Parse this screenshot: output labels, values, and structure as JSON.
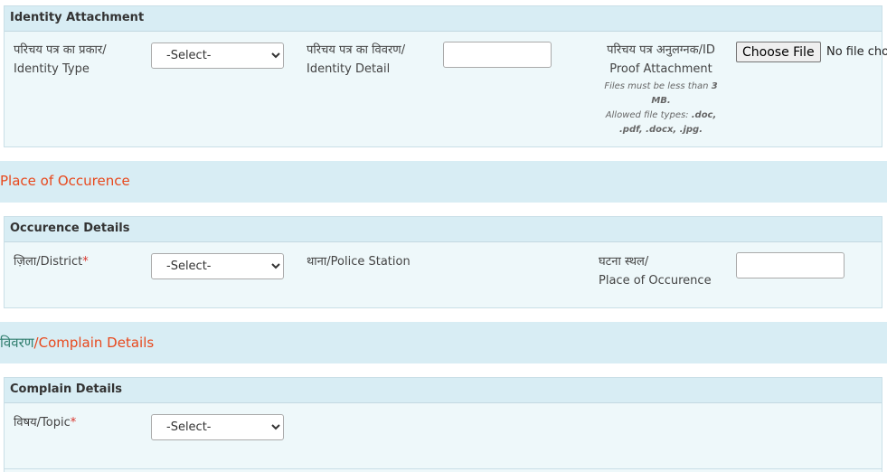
{
  "identity": {
    "header": "Identity Attachment",
    "type_label": [
      "परिचय पत्र का प्रकार/",
      "Identity Type"
    ],
    "type_select": "-Select-",
    "detail_label": [
      "परिचय पत्र का विवरण/",
      "Identity Detail"
    ],
    "detail_value": "",
    "attach_label": [
      "परिचय पत्र अनुलग्नक/ID",
      "Proof Attachment"
    ],
    "size_note": [
      "Files must be less than ",
      "3",
      "MB."
    ],
    "types_note": [
      "Allowed file types: ",
      ".doc,",
      ".pdf, .docx, .jpg."
    ],
    "choose_button": "Choose File",
    "no_file": "No file chosen"
  },
  "place_band": {
    "title": "Place of Occurence"
  },
  "occurence": {
    "header": "Occurence Details",
    "district_label": "ज़िला/District",
    "required_mark": "*",
    "district_select": "-Select-",
    "police_label": "थाना/Police Station",
    "place_label": [
      "घटना स्थल/",
      "Place of Occurence"
    ],
    "place_value": ""
  },
  "complain_band": {
    "title_hi": "विवरण",
    "title_en": "/Complain Details"
  },
  "complain": {
    "header": "Complain Details",
    "topic_label": "विषय/Topic",
    "required_mark": "*",
    "topic_select": "-Select-"
  }
}
